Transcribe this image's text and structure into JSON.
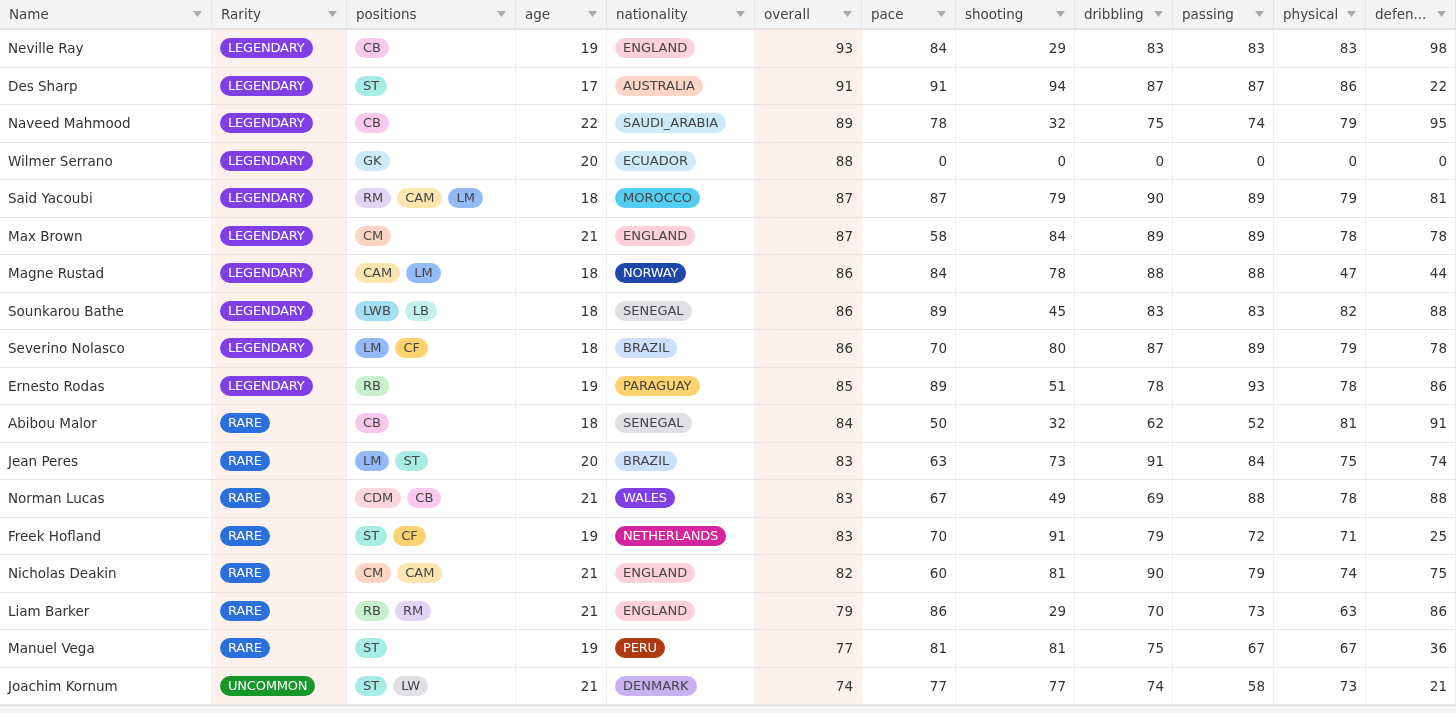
{
  "columns": [
    {
      "label": "Name",
      "highlighted": false
    },
    {
      "label": "Rarity",
      "highlighted": true
    },
    {
      "label": "positions",
      "highlighted": false
    },
    {
      "label": "age",
      "highlighted": false
    },
    {
      "label": "nationality",
      "highlighted": false
    },
    {
      "label": "overall",
      "highlighted": true
    },
    {
      "label": "pace",
      "highlighted": false
    },
    {
      "label": "shooting",
      "highlighted": false
    },
    {
      "label": "dribbling",
      "highlighted": false
    },
    {
      "label": "passing",
      "highlighted": false
    },
    {
      "label": "physical",
      "highlighted": false
    },
    {
      "label": "defen...",
      "highlighted": false
    }
  ],
  "rows": [
    {
      "name": "Neville Ray",
      "rarity": {
        "label": "LEGENDARY",
        "color": "#7f3fe4"
      },
      "positions": [
        {
          "label": "CB",
          "color": "#f9c8ec"
        }
      ],
      "age": "19",
      "nationality": {
        "label": "ENGLAND",
        "color": "#fdd0dc"
      },
      "stats": [
        "93",
        "84",
        "29",
        "83",
        "83",
        "83",
        "98"
      ]
    },
    {
      "name": "Des Sharp",
      "rarity": {
        "label": "LEGENDARY",
        "color": "#7f3fe4"
      },
      "positions": [
        {
          "label": "ST",
          "color": "#a8ece6"
        }
      ],
      "age": "17",
      "nationality": {
        "label": "AUSTRALIA",
        "color": "#fdd5c6"
      },
      "stats": [
        "91",
        "91",
        "94",
        "87",
        "87",
        "86",
        "22"
      ]
    },
    {
      "name": "Naveed Mahmood",
      "rarity": {
        "label": "LEGENDARY",
        "color": "#7f3fe4"
      },
      "positions": [
        {
          "label": "CB",
          "color": "#f9c8ec"
        }
      ],
      "age": "22",
      "nationality": {
        "label": "SAUDI_ARABIA",
        "color": "#cdeaf8"
      },
      "stats": [
        "89",
        "78",
        "32",
        "75",
        "74",
        "79",
        "95"
      ]
    },
    {
      "name": "Wilmer Serrano",
      "rarity": {
        "label": "LEGENDARY",
        "color": "#7f3fe4"
      },
      "positions": [
        {
          "label": "GK",
          "color": "#cdeaf8"
        }
      ],
      "age": "20",
      "nationality": {
        "label": "ECUADOR",
        "color": "#cdeaf8"
      },
      "stats": [
        "88",
        "0",
        "0",
        "0",
        "0",
        "0",
        "0"
      ]
    },
    {
      "name": "Said Yacoubi",
      "rarity": {
        "label": "LEGENDARY",
        "color": "#7f3fe4"
      },
      "positions": [
        {
          "label": "RM",
          "color": "#e0d4f7"
        },
        {
          "label": "CAM",
          "color": "#fde5b0"
        },
        {
          "label": "LM",
          "color": "#93b9f6"
        }
      ],
      "age": "18",
      "nationality": {
        "label": "MOROCCO",
        "color": "#54cdf2"
      },
      "stats": [
        "87",
        "87",
        "79",
        "90",
        "89",
        "79",
        "81"
      ]
    },
    {
      "name": "Max Brown",
      "rarity": {
        "label": "LEGENDARY",
        "color": "#7f3fe4"
      },
      "positions": [
        {
          "label": "CM",
          "color": "#fdd3c3"
        }
      ],
      "age": "21",
      "nationality": {
        "label": "ENGLAND",
        "color": "#fdd0dc"
      },
      "stats": [
        "87",
        "58",
        "84",
        "89",
        "89",
        "78",
        "78"
      ]
    },
    {
      "name": "Magne Rustad",
      "rarity": {
        "label": "LEGENDARY",
        "color": "#7f3fe4"
      },
      "positions": [
        {
          "label": "CAM",
          "color": "#fde5b0"
        },
        {
          "label": "LM",
          "color": "#93b9f6"
        }
      ],
      "age": "18",
      "nationality": {
        "label": "NORWAY",
        "color": "#1f46a8"
      },
      "stats": [
        "86",
        "84",
        "78",
        "88",
        "88",
        "47",
        "44"
      ]
    },
    {
      "name": "Sounkarou Bathe",
      "rarity": {
        "label": "LEGENDARY",
        "color": "#7f3fe4"
      },
      "positions": [
        {
          "label": "LWB",
          "color": "#a4def5"
        },
        {
          "label": "LB",
          "color": "#c2f0ea"
        }
      ],
      "age": "18",
      "nationality": {
        "label": "SENEGAL",
        "color": "#e0e0e4"
      },
      "stats": [
        "86",
        "89",
        "45",
        "83",
        "83",
        "82",
        "88"
      ]
    },
    {
      "name": "Severino Nolasco",
      "rarity": {
        "label": "LEGENDARY",
        "color": "#7f3fe4"
      },
      "positions": [
        {
          "label": "LM",
          "color": "#93b9f6"
        },
        {
          "label": "CF",
          "color": "#fcd36e"
        }
      ],
      "age": "18",
      "nationality": {
        "label": "BRAZIL",
        "color": "#cde0fb"
      },
      "stats": [
        "86",
        "70",
        "80",
        "87",
        "89",
        "79",
        "78"
      ]
    },
    {
      "name": "Ernesto Rodas",
      "rarity": {
        "label": "LEGENDARY",
        "color": "#7f3fe4"
      },
      "positions": [
        {
          "label": "RB",
          "color": "#c7f1cc"
        }
      ],
      "age": "19",
      "nationality": {
        "label": "PARAGUAY",
        "color": "#fcd36e"
      },
      "stats": [
        "85",
        "89",
        "51",
        "78",
        "93",
        "78",
        "86"
      ]
    },
    {
      "name": "Abibou Malor",
      "rarity": {
        "label": "RARE",
        "color": "#2a6fdb"
      },
      "positions": [
        {
          "label": "CB",
          "color": "#f9c8ec"
        }
      ],
      "age": "18",
      "nationality": {
        "label": "SENEGAL",
        "color": "#e0e0e4"
      },
      "stats": [
        "84",
        "50",
        "32",
        "62",
        "52",
        "81",
        "91"
      ]
    },
    {
      "name": "Jean Peres",
      "rarity": {
        "label": "RARE",
        "color": "#2a6fdb"
      },
      "positions": [
        {
          "label": "LM",
          "color": "#93b9f6"
        },
        {
          "label": "ST",
          "color": "#a8ece6"
        }
      ],
      "age": "20",
      "nationality": {
        "label": "BRAZIL",
        "color": "#cde0fb"
      },
      "stats": [
        "83",
        "63",
        "73",
        "91",
        "84",
        "75",
        "74"
      ]
    },
    {
      "name": "Norman Lucas",
      "rarity": {
        "label": "RARE",
        "color": "#2a6fdb"
      },
      "positions": [
        {
          "label": "CDM",
          "color": "#fcd4de"
        },
        {
          "label": "CB",
          "color": "#f9c8ec"
        }
      ],
      "age": "21",
      "nationality": {
        "label": "WALES",
        "color": "#7f3fe4"
      },
      "stats": [
        "83",
        "67",
        "49",
        "69",
        "88",
        "78",
        "88"
      ]
    },
    {
      "name": "Freek Hofland",
      "rarity": {
        "label": "RARE",
        "color": "#2a6fdb"
      },
      "positions": [
        {
          "label": "ST",
          "color": "#a8ece6"
        },
        {
          "label": "CF",
          "color": "#fcd36e"
        }
      ],
      "age": "19",
      "nationality": {
        "label": "NETHERLANDS",
        "color": "#d4249e"
      },
      "stats": [
        "83",
        "70",
        "91",
        "79",
        "72",
        "71",
        "25"
      ]
    },
    {
      "name": "Nicholas Deakin",
      "rarity": {
        "label": "RARE",
        "color": "#2a6fdb"
      },
      "positions": [
        {
          "label": "CM",
          "color": "#fdd3c3"
        },
        {
          "label": "CAM",
          "color": "#fde5b0"
        }
      ],
      "age": "21",
      "nationality": {
        "label": "ENGLAND",
        "color": "#fdd0dc"
      },
      "stats": [
        "82",
        "60",
        "81",
        "90",
        "79",
        "74",
        "75"
      ]
    },
    {
      "name": "Liam Barker",
      "rarity": {
        "label": "RARE",
        "color": "#2a6fdb"
      },
      "positions": [
        {
          "label": "RB",
          "color": "#c7f1cc"
        },
        {
          "label": "RM",
          "color": "#e0d4f7"
        }
      ],
      "age": "21",
      "nationality": {
        "label": "ENGLAND",
        "color": "#fdd0dc"
      },
      "stats": [
        "79",
        "86",
        "29",
        "70",
        "73",
        "63",
        "86"
      ]
    },
    {
      "name": "Manuel Vega",
      "rarity": {
        "label": "RARE",
        "color": "#2a6fdb"
      },
      "positions": [
        {
          "label": "ST",
          "color": "#a8ece6"
        }
      ],
      "age": "19",
      "nationality": {
        "label": "PERU",
        "color": "#b03a10"
      },
      "stats": [
        "77",
        "81",
        "81",
        "75",
        "67",
        "67",
        "36"
      ]
    },
    {
      "name": "Joachim Kornum",
      "rarity": {
        "label": "UNCOMMON",
        "color": "#17962a"
      },
      "positions": [
        {
          "label": "ST",
          "color": "#a8ece6"
        },
        {
          "label": "LW",
          "color": "#e0e0e4"
        }
      ],
      "age": "21",
      "nationality": {
        "label": "DENMARK",
        "color": "#c9b0f2"
      },
      "stats": [
        "74",
        "77",
        "77",
        "74",
        "58",
        "73",
        "21"
      ]
    }
  ]
}
